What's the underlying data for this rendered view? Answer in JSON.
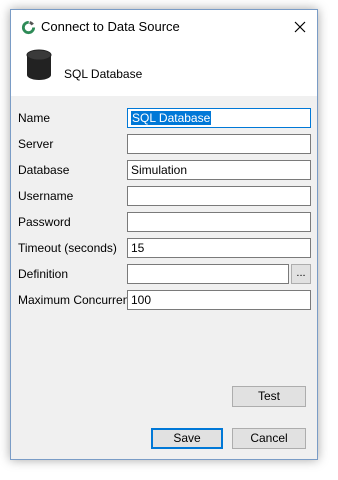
{
  "window": {
    "title": "Connect to Data Source",
    "header_label": "SQL Database"
  },
  "form": {
    "fields": [
      {
        "label": "Name",
        "value": "SQL Database"
      },
      {
        "label": "Server",
        "value": ""
      },
      {
        "label": "Database",
        "value": "Simulation"
      },
      {
        "label": "Username",
        "value": ""
      },
      {
        "label": "Password",
        "value": ""
      },
      {
        "label": "Timeout (seconds)",
        "value": "15"
      },
      {
        "label": "Definition",
        "value": ""
      },
      {
        "label": "Maximum Concurrent",
        "value": "100"
      }
    ],
    "browse_label": "..."
  },
  "buttons": {
    "test": "Test",
    "save": "Save",
    "cancel": "Cancel"
  },
  "colors": {
    "accent": "#0078d7",
    "dialog_body": "#f0f0f0",
    "app_icon_green": "#2e8b57"
  },
  "icons": {
    "app": "app-ring-icon",
    "database": "database-cylinder-icon",
    "close": "close-x-icon"
  }
}
